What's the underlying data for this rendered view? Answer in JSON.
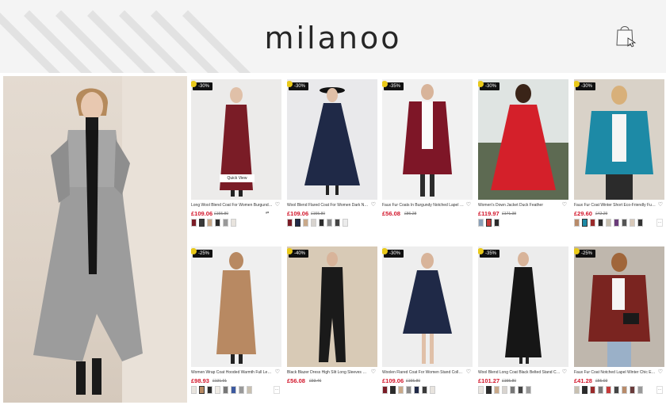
{
  "brand": {
    "logo_text": "milanoo",
    "cart_icon": "shopping-bag-icon"
  },
  "colors": {
    "price": "#d2162b",
    "badge_bg": "#111111",
    "badge_dot": "#e9c91a",
    "header_bg": "#f4f4f4"
  },
  "hero": {
    "alt": "Woman in long grey wool coat"
  },
  "products": [
    {
      "badge": "-30%",
      "title": "Long Wool Blend Coat For Women Burgundy Double-br...",
      "price": "£109.06",
      "old_price": "£155.80",
      "quick_view": "Quick View",
      "bg": "#ecebea",
      "coat": "#7a1c26",
      "swatches": [
        "#7a1c26",
        "#3a3a3a",
        "#c9a98a",
        "#2b2b2b",
        "#999",
        "#e8e4de"
      ]
    },
    {
      "badge": "-30%",
      "title": "Wool Blend Flared Coat For Women Dark Navy Double-b...",
      "price": "£109.06",
      "old_price": "£155.80",
      "bg": "#e9e9eb",
      "coat": "#1f2947",
      "swatches": [
        "#7a1c26",
        "#1f2947",
        "#c9a98a",
        "#d8d4cf",
        "#2b2b2b",
        "#8a8a8a",
        "#444",
        "#ececec"
      ]
    },
    {
      "badge": "-35%",
      "title": "Faux Fur Coats In Burgundy Notched Lapel Winter Long ...",
      "price": "£56.08",
      "old_price": "£86.28",
      "bg": "#f1f1f1",
      "coat": "#7e1627",
      "swatches": []
    },
    {
      "badge": "-30%",
      "title": "Women's Down Jacket Duck Feather",
      "price": "£119.97",
      "old_price": "£171.38",
      "bg": "#5d6a52",
      "coat": "#d4202a",
      "swatches": [
        "#8aa0b8",
        "#c63a3a",
        "#2b2b2b"
      ]
    },
    {
      "badge": "-30%",
      "title": "Faux Fur Coat Winter Short Eco-Friendly Fur Coat For Wo...",
      "price": "£29.60",
      "old_price": "£42.29",
      "bg": "#d9d2c8",
      "coat": "#1d8aa6",
      "swatches": [
        "#b88b6a",
        "#1d8aa6",
        "#9a2a2a",
        "#2b2b2b",
        "#c8c0b0",
        "#6a3b7a",
        "#555",
        "#d8c8b8",
        "#333"
      ]
    },
    {
      "badge": "-25%",
      "title": "Women Wrap Coat Hooded Warmth Full Length Winter ...",
      "price": "£98.93",
      "old_price": "£131.91",
      "bg": "#efefef",
      "coat": "#b88962",
      "swatches": [
        "#e8e4de",
        "#b88962",
        "#2b2b2b",
        "#f0ece6",
        "#777",
        "#3c5aa0",
        "#999",
        "#c8c0b0"
      ]
    },
    {
      "badge": "-40%",
      "title": "Black Blazer Dress High Slit Long Sleeves Work Office Ca...",
      "price": "£56.08",
      "old_price": "£93.46",
      "bg": "#d8cab6",
      "coat": "#1a1a1a",
      "swatches": []
    },
    {
      "badge": "-30%",
      "title": "Woolen Flared Coat For Women Stand Collar Dark Navy ...",
      "price": "£109.06",
      "old_price": "£155.80",
      "bg": "#eeeeee",
      "coat": "#1f2947",
      "swatches": [
        "#7a1c26",
        "#2b2b2b",
        "#c9a98a",
        "#8a8a8a",
        "#1f2947",
        "#3a3a3a",
        "#e8e4de"
      ]
    },
    {
      "badge": "-35%",
      "title": "Wool Blend Long Coat Black Belted Stand Collar Winter F...",
      "price": "£101.27",
      "old_price": "£155.80",
      "bg": "#ececec",
      "coat": "#161616",
      "swatches": [
        "#e8e4de",
        "#2b2b2b",
        "#c9a98a",
        "#d8d4cf",
        "#777",
        "#444",
        "#999"
      ]
    },
    {
      "badge": "-25%",
      "title": "Faux Fur Coat Notched Lapel Winter Chic Eco-friendly Lo...",
      "price": "£41.28",
      "old_price": "£55.03",
      "bg": "#bfb7ad",
      "coat": "#7a2420",
      "swatches": [
        "#c8c0b0",
        "#2b2b2b",
        "#9a2a2a",
        "#777",
        "#c63a3a",
        "#444",
        "#b88b6a",
        "#6a3b3a",
        "#999"
      ]
    }
  ],
  "compare_label": "⇄",
  "more_label": "···"
}
